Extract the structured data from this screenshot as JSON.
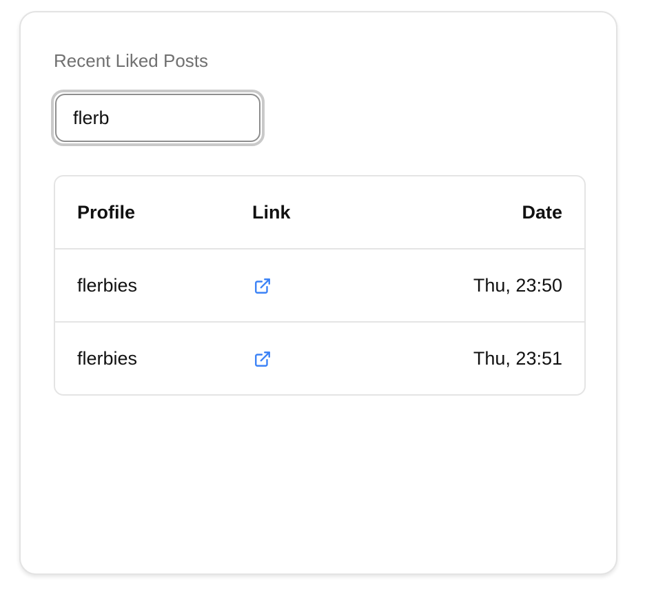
{
  "card": {
    "title": "Recent Liked Posts"
  },
  "search": {
    "value": "flerb",
    "placeholder": ""
  },
  "table": {
    "columns": {
      "profile": "Profile",
      "link": "Link",
      "date": "Date"
    },
    "rows": [
      {
        "profile": "flerbies",
        "link_icon": "external-link-icon",
        "date": "Thu, 23:50"
      },
      {
        "profile": "flerbies",
        "link_icon": "external-link-icon",
        "date": "Thu, 23:51"
      }
    ]
  },
  "colors": {
    "link_icon": "#3b82f6",
    "border": "#e4e4e4",
    "title_text": "#707070"
  }
}
